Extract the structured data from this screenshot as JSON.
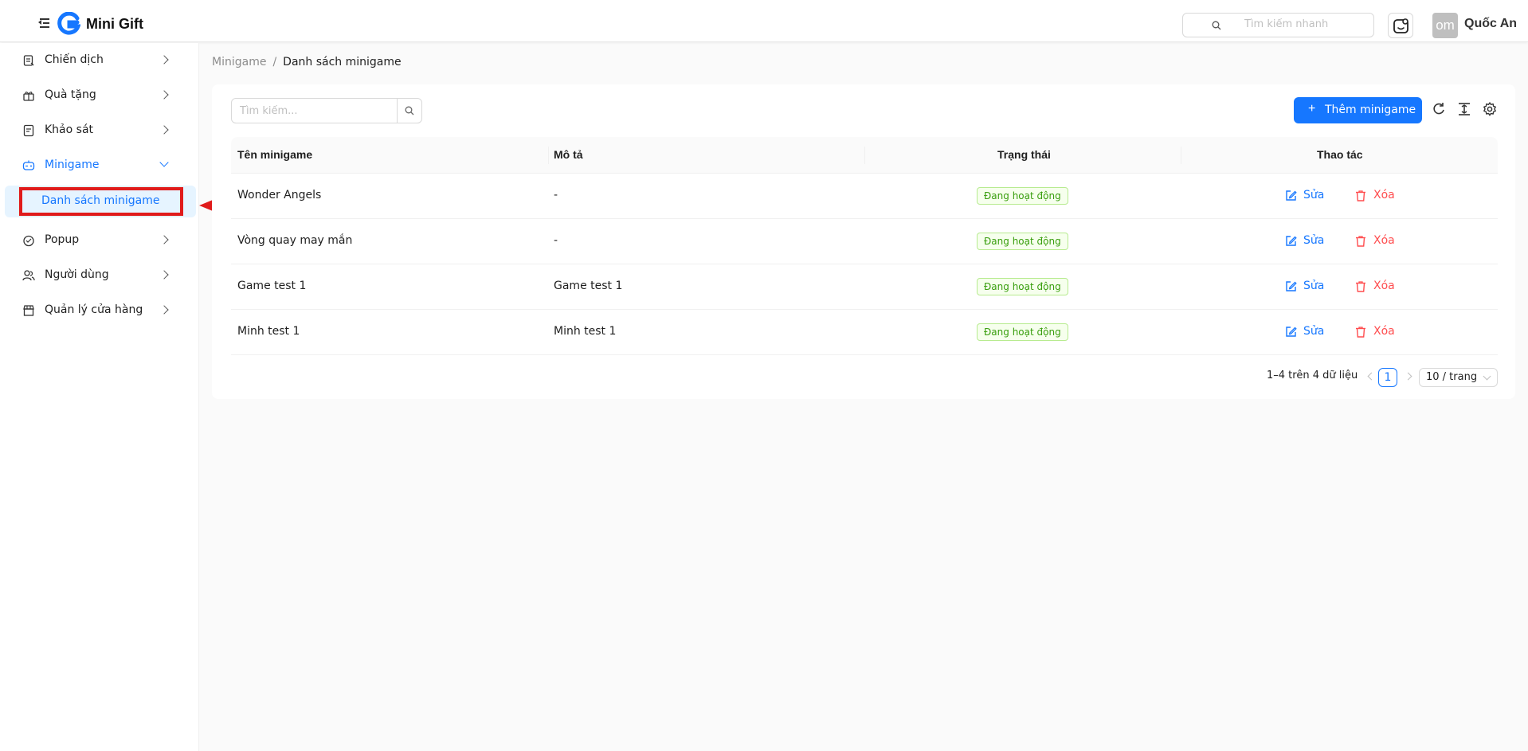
{
  "header": {
    "app_title": "Mini Gift",
    "quick_search_placeholder": "Tìm kiếm nhanh",
    "avatar_initials": "om",
    "user_name": "Quốc An"
  },
  "sidebar": {
    "items": [
      {
        "label": "Chiến dịch",
        "icon": "campaign-icon"
      },
      {
        "label": "Quà tặng",
        "icon": "gift-icon"
      },
      {
        "label": "Khảo sát",
        "icon": "survey-icon"
      },
      {
        "label": "Minigame",
        "icon": "game-icon",
        "expanded": true
      },
      {
        "label": "Popup",
        "icon": "popup-icon"
      },
      {
        "label": "Người dùng",
        "icon": "users-icon"
      },
      {
        "label": "Quản lý cửa hàng",
        "icon": "store-icon"
      }
    ],
    "sub_item": {
      "label": "Danh sách minigame",
      "selected": true
    }
  },
  "breadcrumb": {
    "parent": "Minigame",
    "separator": "/",
    "current": "Danh sách minigame"
  },
  "toolbar": {
    "search_placeholder": "Tìm kiếm...",
    "add_label": "Thêm minigame",
    "add_icon": "+"
  },
  "table": {
    "columns": [
      "Tên minigame",
      "Mô tả",
      "Trạng thái",
      "Thao tác"
    ],
    "rows": [
      {
        "name": "Wonder Angels",
        "description": "-",
        "status": "Đang hoạt động",
        "edit": "Sửa",
        "delete": "Xóa"
      },
      {
        "name": "Vòng quay may mắn",
        "description": "-",
        "status": "Đang hoạt động",
        "edit": "Sửa",
        "delete": "Xóa"
      },
      {
        "name": "Game test 1",
        "description": "Game test 1",
        "status": "Đang hoạt động",
        "edit": "Sửa",
        "delete": "Xóa"
      },
      {
        "name": "Minh test 1",
        "description": "Minh test 1",
        "status": "Đang hoạt động",
        "edit": "Sửa",
        "delete": "Xóa"
      }
    ]
  },
  "pagination": {
    "total_text": "1–4 trên 4 dữ liệu",
    "current_page": "1",
    "page_size": "10 / trang"
  },
  "colors": {
    "primary": "#1677ff",
    "danger": "#ff4d4f",
    "success": "#389e0d",
    "annotation": "#e01b1b"
  }
}
